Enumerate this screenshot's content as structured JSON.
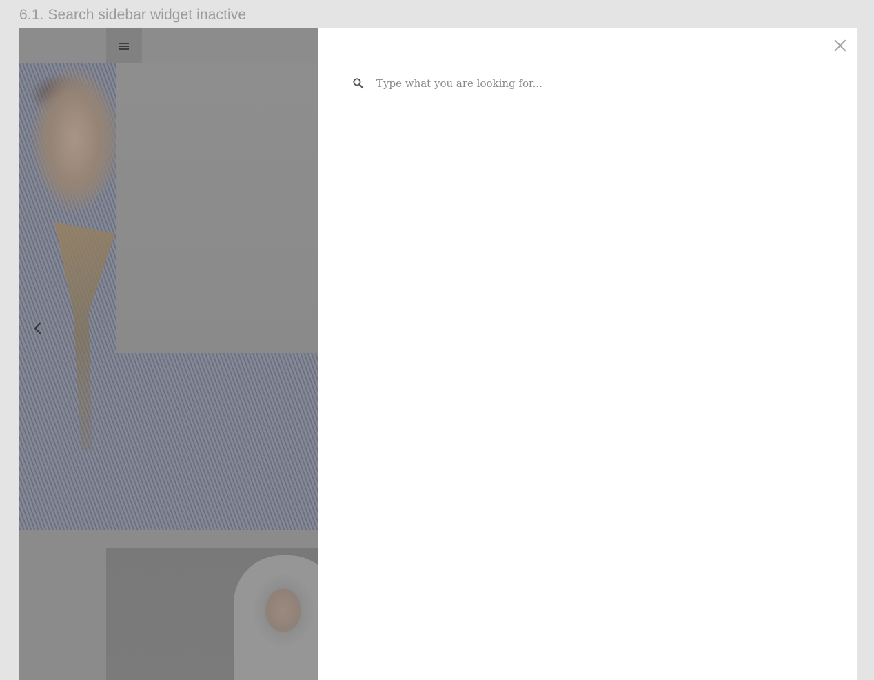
{
  "heading": "6.1. Search sidebar widget inactive",
  "background_page": {
    "menu_icon": "hamburger-menu-icon",
    "carousel_prev_icon": "chevron-left-icon"
  },
  "search_panel": {
    "close_icon": "close-icon",
    "search_icon": "search-icon",
    "input_placeholder": "Type what you are looking for...",
    "input_value": ""
  },
  "colors": {
    "page_background": "#e4e4e4",
    "overlay_tint": "#8b8b8b",
    "panel_background": "#ffffff",
    "heading_text": "#9b9b9b",
    "icon_gray": "#a5a5a5"
  }
}
